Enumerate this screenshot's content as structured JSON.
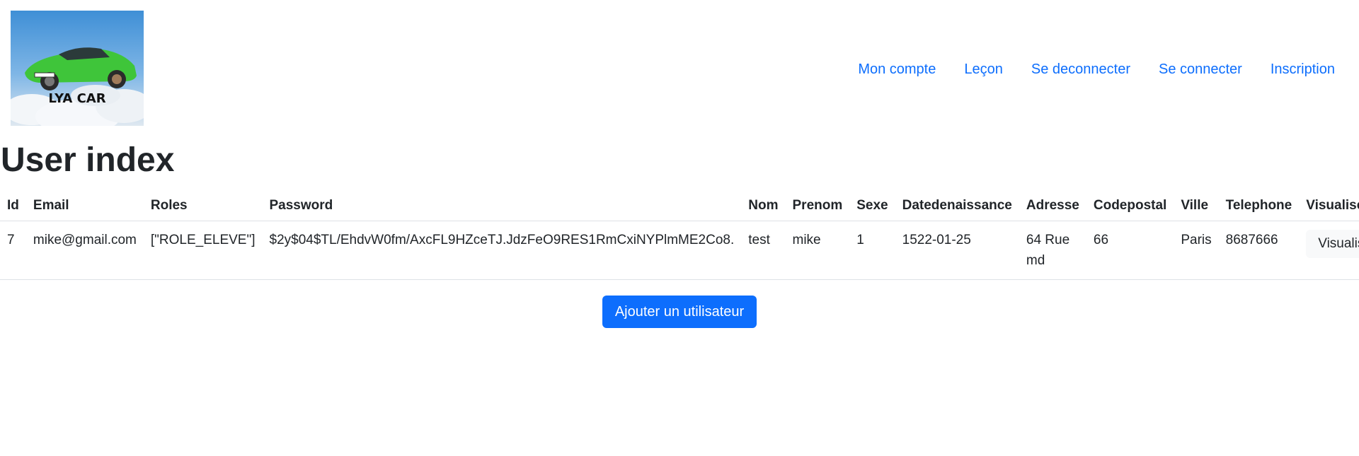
{
  "header": {
    "logo_text": "LYA CAR",
    "nav": [
      {
        "label": "Mon compte"
      },
      {
        "label": "Leçon"
      },
      {
        "label": "Se deconnecter"
      },
      {
        "label": "Se connecter"
      },
      {
        "label": "Inscription"
      }
    ]
  },
  "main": {
    "title": "User index",
    "table": {
      "columns": [
        "Id",
        "Email",
        "Roles",
        "Password",
        "Nom",
        "Prenom",
        "Sexe",
        "Datedenaissance",
        "Adresse",
        "Codepostal",
        "Ville",
        "Telephone",
        "Visualiser"
      ],
      "rows": [
        {
          "id": "7",
          "email": "mike@gmail.com",
          "roles": "[\"ROLE_ELEVE\"]",
          "password": "$2y$04$TL/EhdvW0fm/AxcFL9HZceTJ.JdzFeO9RES1RmCxiNYPlmME2Co8.",
          "nom": "test",
          "prenom": "mike",
          "sexe": "1",
          "datedenaissance": "1522-01-25",
          "adresse": "64 Rue md",
          "codepostal": "66",
          "ville": "Paris",
          "telephone": "8687666",
          "action_label": "Visualiser"
        }
      ]
    },
    "add_button_label": "Ajouter un utilisateur"
  },
  "colors": {
    "link": "#0d6efd",
    "primary_button": "#0d6efd",
    "light_button": "#f8f9fa",
    "border": "#dee2e6"
  }
}
